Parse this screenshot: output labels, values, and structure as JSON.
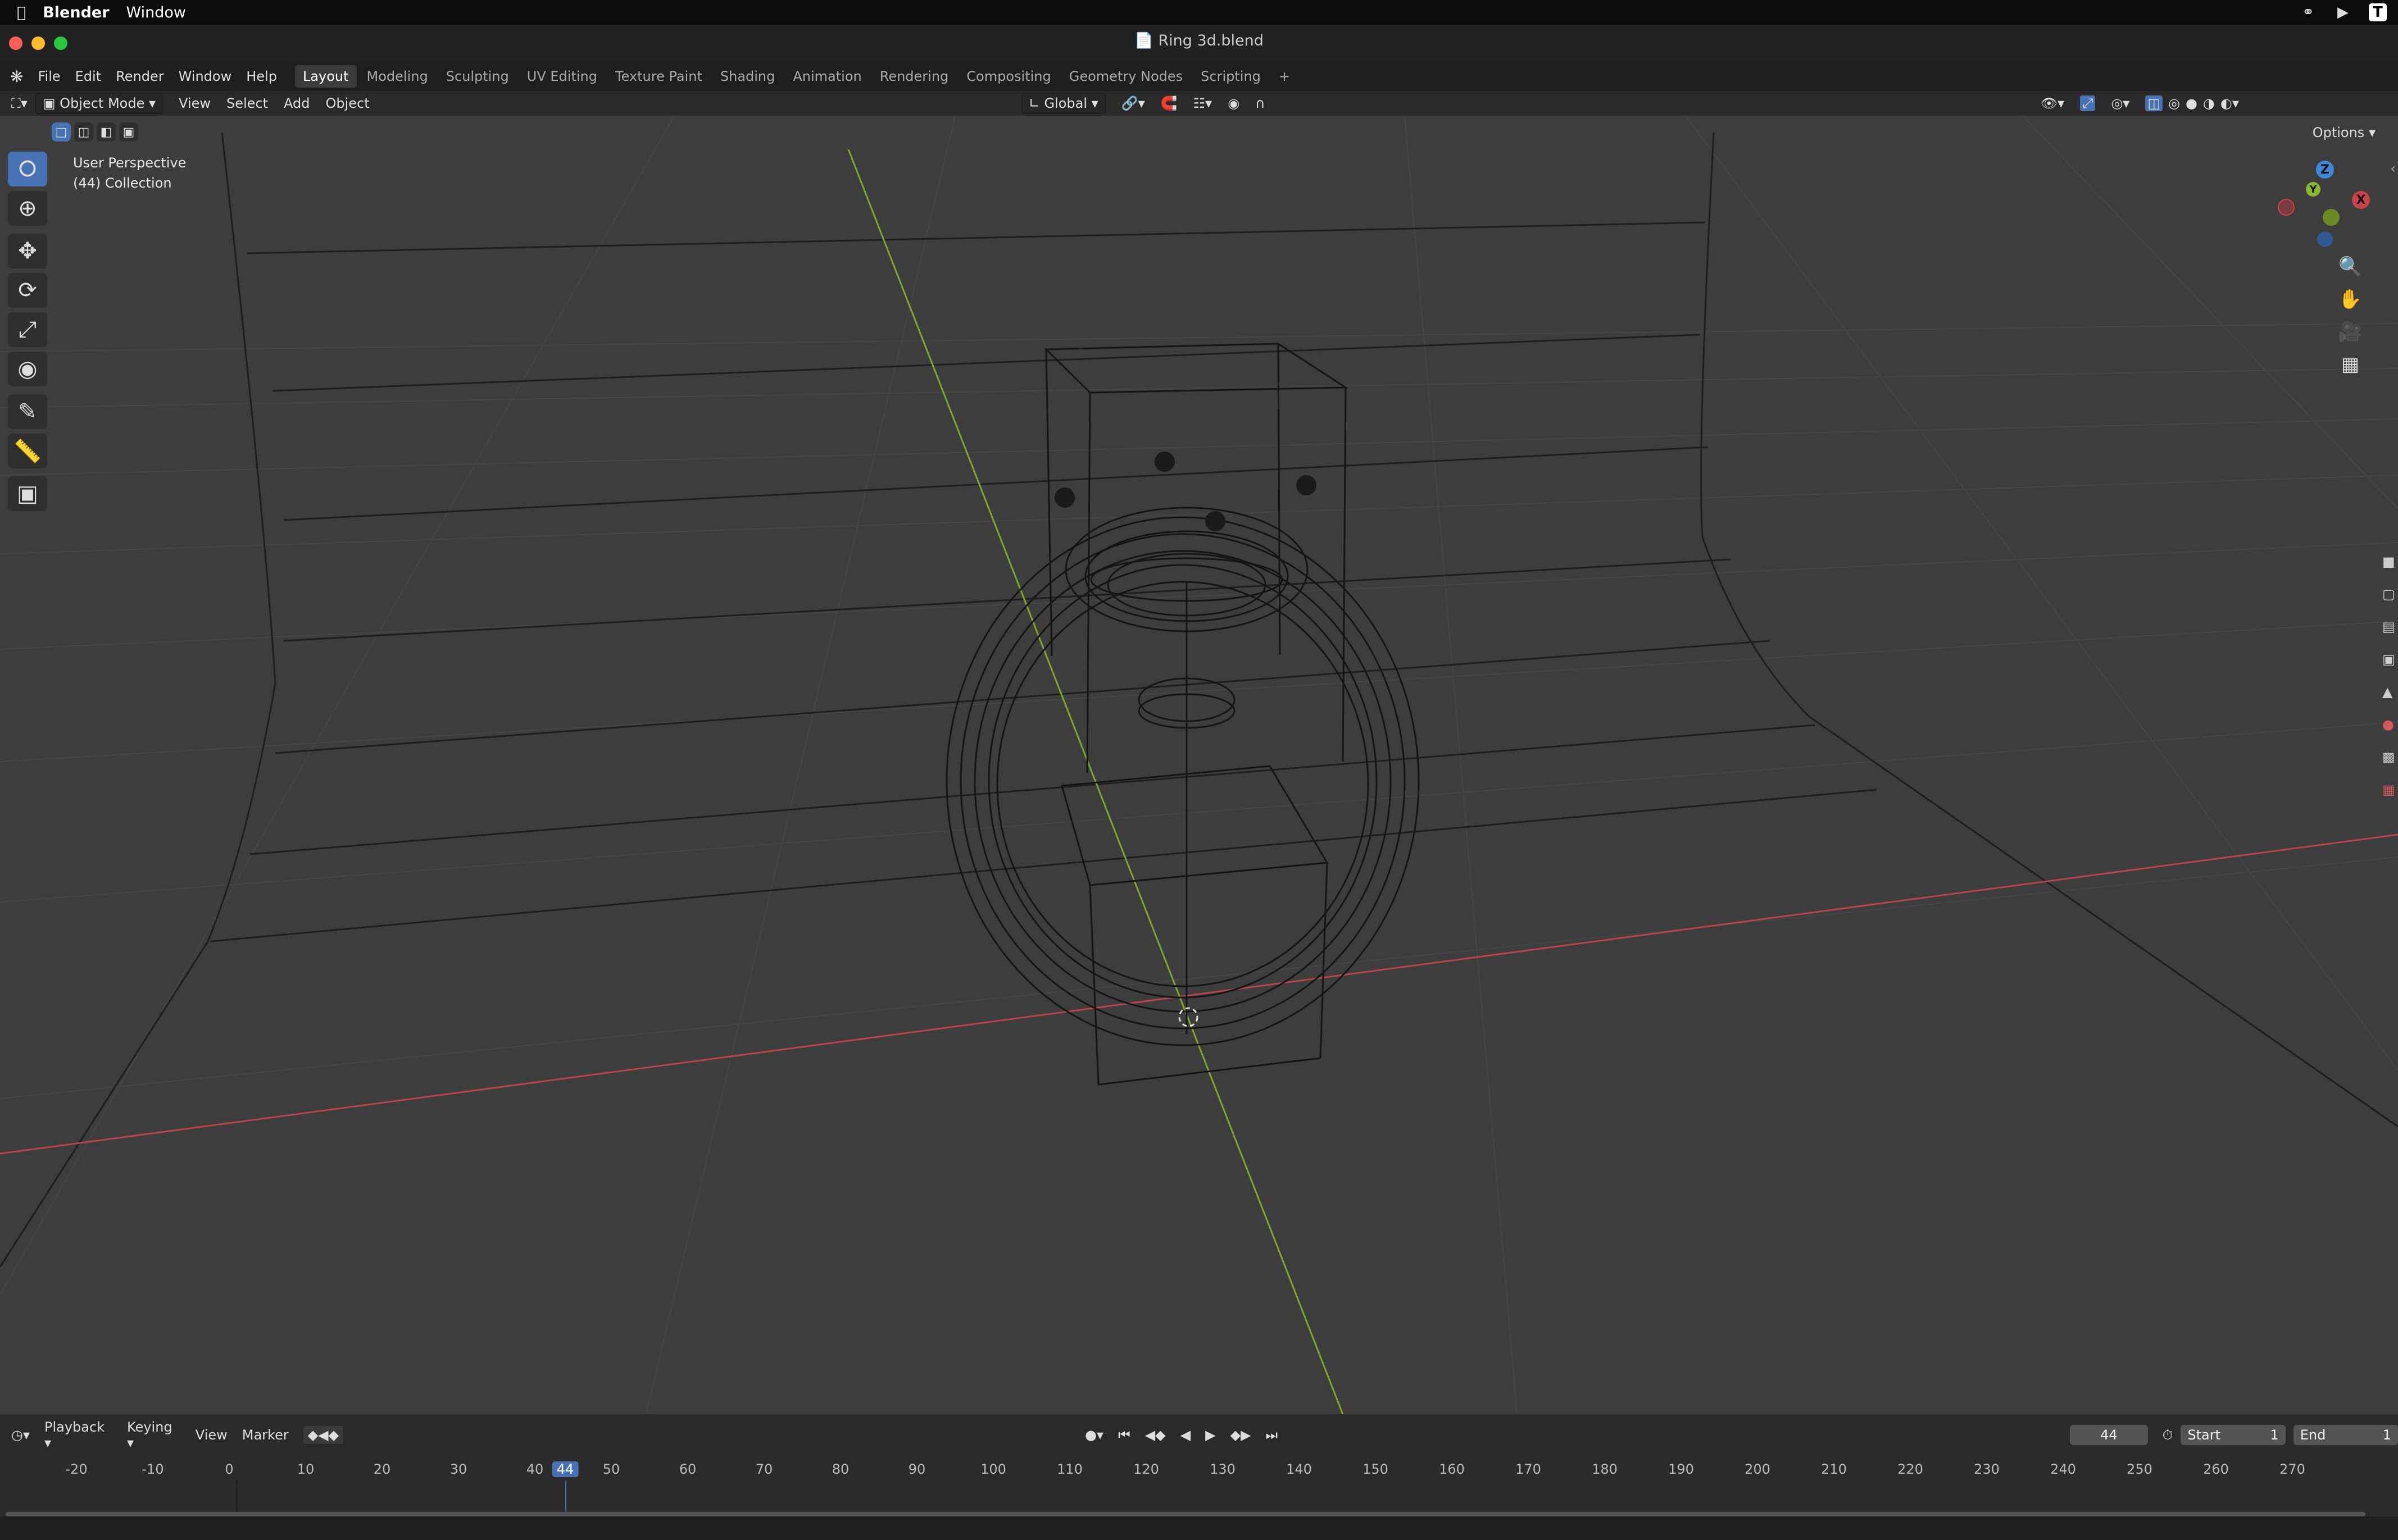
{
  "menubar": {
    "app": "Blender",
    "window": "Window"
  },
  "titlebar": {
    "title": "Ring 3d.blend"
  },
  "topbar": {
    "menus": [
      "File",
      "Edit",
      "Render",
      "Window",
      "Help"
    ],
    "workspaces": [
      "Layout",
      "Modeling",
      "Sculpting",
      "UV Editing",
      "Texture Paint",
      "Shading",
      "Animation",
      "Rendering",
      "Compositing",
      "Geometry Nodes",
      "Scripting"
    ],
    "active_workspace": "Layout",
    "add_tab": "+"
  },
  "header": {
    "mode": "Object Mode",
    "menus": [
      "View",
      "Select",
      "Add",
      "Object"
    ],
    "orientation": "Global",
    "options": "Options"
  },
  "viewport": {
    "perspective": "User Perspective",
    "collection": "(44) Collection",
    "gizmo": {
      "z": "Z",
      "y": "Y",
      "x": "X"
    }
  },
  "timeline": {
    "menus": [
      "Playback",
      "Keying",
      "View",
      "Marker"
    ],
    "current_frame": "44",
    "start_label": "Start",
    "start_value": "1",
    "end_label": "End",
    "end_value": "1",
    "ticks": [
      "-20",
      "-10",
      "0",
      "10",
      "20",
      "30",
      "40",
      "44",
      "50",
      "60",
      "70",
      "80",
      "90",
      "100",
      "110",
      "120",
      "130",
      "140",
      "150",
      "160",
      "170",
      "180",
      "190",
      "200",
      "210",
      "220",
      "230",
      "240",
      "250",
      "260",
      "270"
    ]
  },
  "colors": {
    "accent": "#4772b3",
    "x_axis": "#c9434d",
    "y_axis": "#8bb72f",
    "z_axis": "#3f87d8"
  }
}
